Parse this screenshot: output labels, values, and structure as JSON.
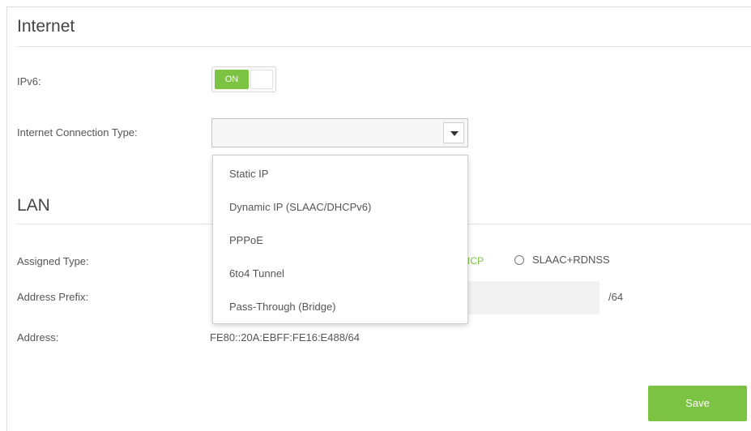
{
  "internet": {
    "title": "Internet",
    "ipv6_label": "IPv6:",
    "ipv6_toggle_text": "ON",
    "connection_type_label": "Internet Connection Type:",
    "connection_type_value": "",
    "connection_options": [
      "Static IP",
      "Dynamic IP (SLAAC/DHCPv6)",
      "PPPoE",
      "6to4 Tunnel",
      "Pass-Through (Bridge)"
    ]
  },
  "lan": {
    "title": "LAN",
    "assigned_type_label": "Assigned Type:",
    "assigned_type_partial": "ICP",
    "assigned_type_option": "SLAAC+RDNSS",
    "address_prefix_label": "Address Prefix:",
    "address_prefix_value": "",
    "address_prefix_suffix": "/64",
    "address_label": "Address:",
    "address_value": "FE80::20A:EBFF:FE16:E488/64"
  },
  "actions": {
    "save_label": "Save"
  },
  "colors": {
    "accent": "#7cc243",
    "border": "#dcdcdc",
    "text": "#555555"
  }
}
